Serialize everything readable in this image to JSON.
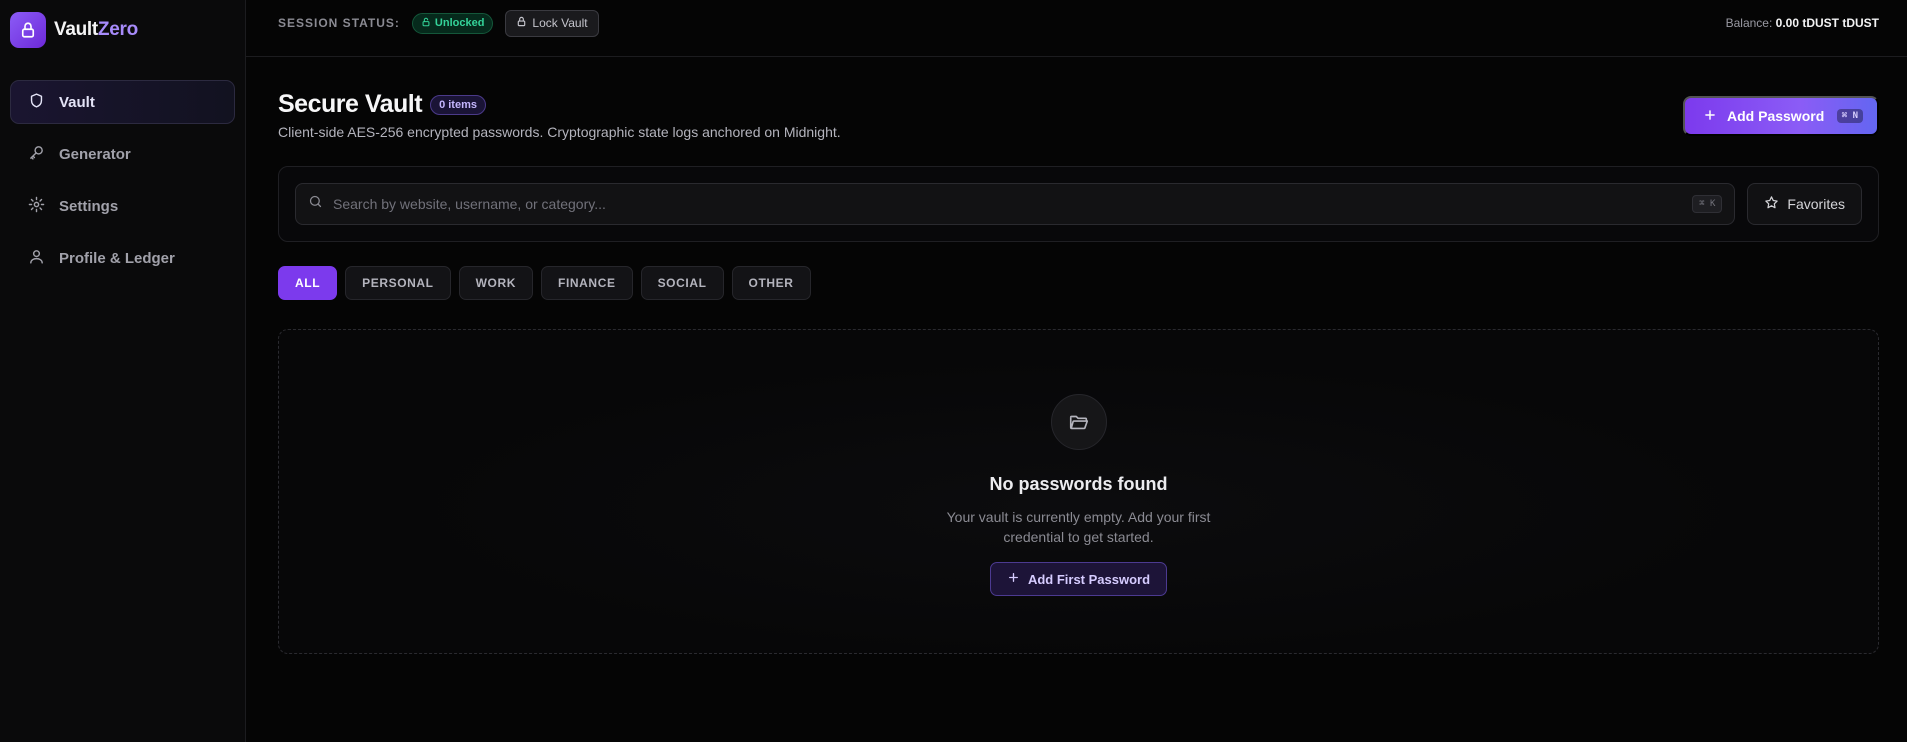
{
  "brand": {
    "name_part1": "Vault",
    "name_part2": "Zero",
    "icon": "lock-icon",
    "accent": "#8b5cf6"
  },
  "sidebar": {
    "items": [
      {
        "label": "Vault",
        "icon": "shield-icon",
        "active": true
      },
      {
        "label": "Generator",
        "icon": "key-icon",
        "active": false
      },
      {
        "label": "Settings",
        "icon": "gear-icon",
        "active": false
      },
      {
        "label": "Profile & Ledger",
        "icon": "user-icon",
        "active": false
      }
    ]
  },
  "topbar": {
    "session_label": "SESSION STATUS:",
    "status_badge": "Unlocked",
    "status_color": "#34d399",
    "lock_button": "Lock Vault",
    "balance_label": "Balance:",
    "balance_value": "0.00 tDUST tDUST"
  },
  "header": {
    "title": "Secure Vault",
    "count_badge": "0 items",
    "subtitle": "Client-side AES-256 encrypted passwords. Cryptographic state logs anchored on Midnight.",
    "add_button": "Add Password",
    "add_shortcut": "⌘ N"
  },
  "search": {
    "placeholder": "Search by website, username, or category...",
    "value": "",
    "shortcut": "⌘ K",
    "favorites_button": "Favorites"
  },
  "filters": {
    "tabs": [
      {
        "label": "ALL",
        "active": true
      },
      {
        "label": "PERSONAL",
        "active": false
      },
      {
        "label": "WORK",
        "active": false
      },
      {
        "label": "FINANCE",
        "active": false
      },
      {
        "label": "SOCIAL",
        "active": false
      },
      {
        "label": "OTHER",
        "active": false
      }
    ]
  },
  "empty_state": {
    "icon": "folder-open-icon",
    "title": "No passwords found",
    "text": "Your vault is currently empty. Add your first credential to get started.",
    "button": "Add First Password"
  }
}
